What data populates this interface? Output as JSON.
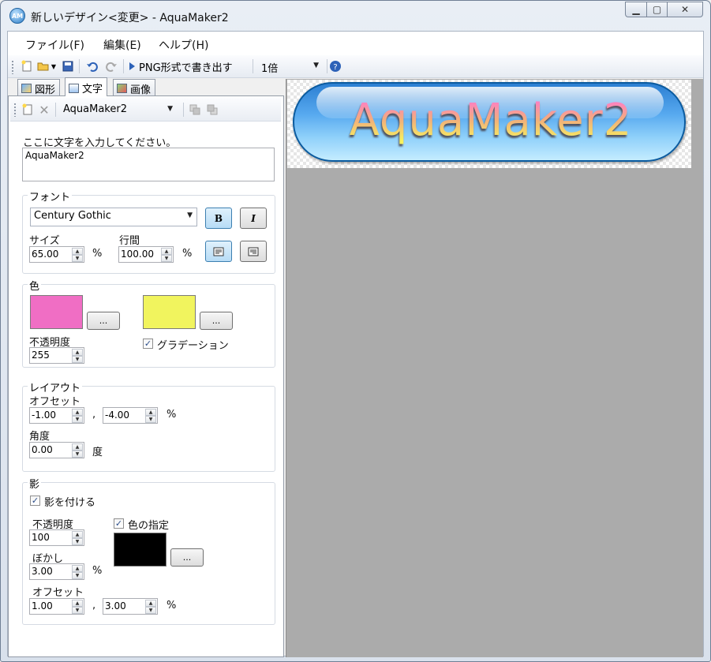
{
  "window": {
    "title": "新しいデザイン<変更> - AquaMaker2",
    "app_icon_text": "AM",
    "min_glyph": "▁",
    "max_glyph": "▢",
    "close_glyph": "✕"
  },
  "menu": [
    "ファイル(F)",
    "編集(E)",
    "ヘルプ(H)"
  ],
  "toolbar": {
    "export_label": "PNG形式で書き出す",
    "zoom_value": "1倍"
  },
  "tabs": [
    "図形",
    "文字",
    "画像"
  ],
  "text_tab": {
    "item_select": "AquaMaker2",
    "prompt_label": "ここに文字を入力してください。",
    "text_value": "AquaMaker2",
    "font_group": {
      "title": "フォント",
      "font_name": "Century Gothic",
      "bold_label": "B",
      "italic_label": "I",
      "size_label": "サイズ",
      "size_value": "65.00",
      "size_unit": "%",
      "line_label": "行間",
      "line_value": "100.00",
      "line_unit": "%"
    },
    "color_group": {
      "title": "色",
      "color1": "#f06ec4",
      "color2": "#f1f45e",
      "browse_label": "...",
      "opacity_label": "不透明度",
      "opacity_value": "255",
      "gradient_label": "グラデーション"
    },
    "layout_group": {
      "title": "レイアウト",
      "offset_label": "オフセット",
      "offset_x": "-1.00",
      "offset_y": "-4.00",
      "comma": ",",
      "offset_unit": "%",
      "angle_label": "角度",
      "angle_value": "0.00",
      "angle_unit": "度"
    },
    "shadow_group": {
      "title": "影",
      "enable_label": "影を付ける",
      "opacity_label": "不透明度",
      "opacity_value": "100",
      "color_spec_label": "色の指定",
      "shadow_color": "#000000",
      "blur_label": "ぼかし",
      "blur_value": "3.00",
      "blur_unit": "%",
      "offset_label": "オフセット",
      "offset_x": "1.00",
      "offset_y": "3.00",
      "comma": ",",
      "offset_unit": "%"
    }
  },
  "preview": {
    "button_text": "AquaMaker2"
  }
}
